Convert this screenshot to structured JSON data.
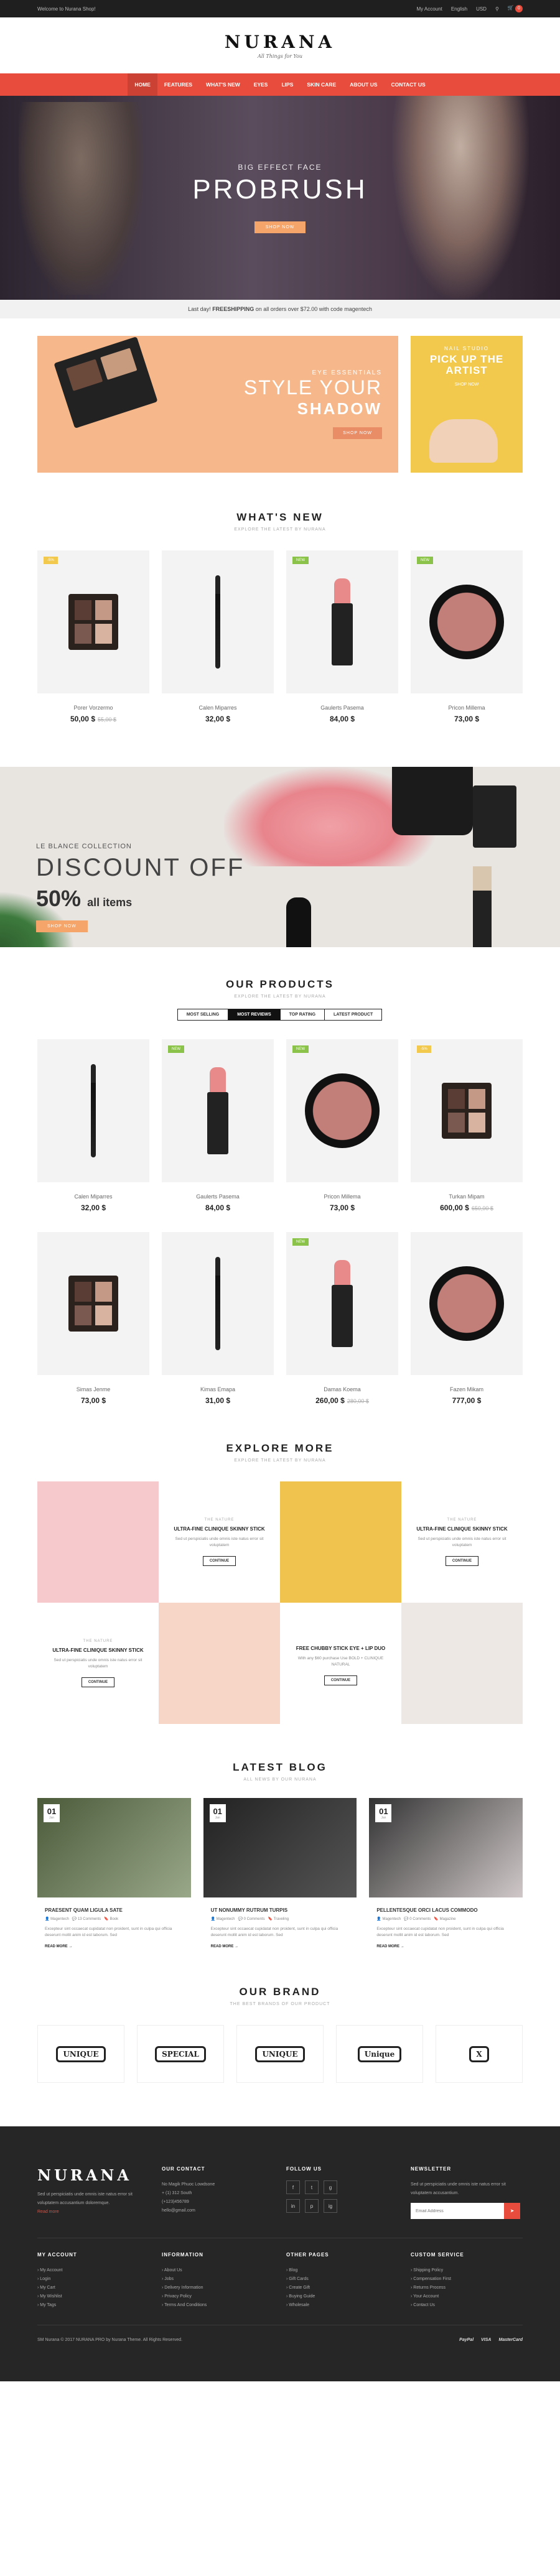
{
  "topbar": {
    "welcome": "Welcome to Nurana Shop!",
    "account": "My Account",
    "language": "English",
    "currency": "USD",
    "cart_count": "0"
  },
  "brand": {
    "logo": "NURANA",
    "tagline": "All Things for You"
  },
  "nav": [
    "HOME",
    "FEATURES",
    "WHAT'S NEW",
    "EYES",
    "LIPS",
    "SKIN CARE",
    "ABOUT US",
    "CONTACT US"
  ],
  "hero": {
    "pre": "BIG EFFECT FACE",
    "title": "PROBRUSH",
    "button": "SHOP NOW"
  },
  "shipping": {
    "pre": "Last day!",
    "bold": "FREESHIPPING",
    "post": "on all orders over $72.00 with code magentech"
  },
  "promo1": {
    "sub": "EYE ESSENTIALS",
    "title": "STYLE YOUR",
    "title2": "SHADOW",
    "button": "SHOP NOW"
  },
  "promo2": {
    "sub": "NAIL STUDIO",
    "title": "PICK UP THE ARTIST",
    "button": "SHOP NOW"
  },
  "whats_new": {
    "title": "WHAT'S NEW",
    "sub": "EXPLORE THE LATEST BY NURANA",
    "items": [
      {
        "badge": "-5%",
        "badge_color": "#f2c94c",
        "name": "Porer Vorzermo",
        "price": "50,00 $",
        "old": "55,00 $"
      },
      {
        "badge": "",
        "badge_color": "",
        "name": "Calen Miparres",
        "price": "32,00 $",
        "old": ""
      },
      {
        "badge": "NEW",
        "badge_color": "#8bc34a",
        "name": "Gaulerts Pasema",
        "price": "84,00 $",
        "old": ""
      },
      {
        "badge": "NEW",
        "badge_color": "#8bc34a",
        "name": "Pricon Millema",
        "price": "73,00 $",
        "old": ""
      }
    ]
  },
  "discount": {
    "collection": "LE BLANCE COLLECTION",
    "title": "DISCOUNT OFF",
    "percent": "50%",
    "suffix": "all items",
    "button": "SHOP NOW"
  },
  "products": {
    "title": "OUR PRODUCTS",
    "sub": "EXPLORE THE LATEST BY NURANA",
    "tabs": [
      "MOST SELLING",
      "MOST REVIEWS",
      "TOP RATING",
      "LATEST PRODUCT"
    ],
    "items": [
      {
        "badge": "",
        "badge_color": "",
        "name": "Calen Miparres",
        "price": "32,00 $",
        "old": ""
      },
      {
        "badge": "NEW",
        "badge_color": "#8bc34a",
        "name": "Gaulerts Pasema",
        "price": "84,00 $",
        "old": ""
      },
      {
        "badge": "NEW",
        "badge_color": "#8bc34a",
        "name": "Pricon Millema",
        "price": "73,00 $",
        "old": ""
      },
      {
        "badge": "-5%",
        "badge_color": "#f2c94c",
        "name": "Turkan Mipam",
        "price": "600,00 $",
        "old": "650,00 $"
      },
      {
        "badge": "",
        "badge_color": "",
        "name": "Simas Jenme",
        "price": "73,00 $",
        "old": ""
      },
      {
        "badge": "",
        "badge_color": "",
        "name": "Kimas Emapa",
        "price": "31,00 $",
        "old": ""
      },
      {
        "badge": "NEW",
        "badge_color": "#8bc34a",
        "name": "Damas Koema",
        "price": "260,00 $",
        "old": "280,00 $"
      },
      {
        "badge": "",
        "badge_color": "",
        "name": "Fazen Mikam",
        "price": "777,00 $",
        "old": ""
      }
    ]
  },
  "explore": {
    "title": "EXPLORE MORE",
    "sub": "EXPLORE THE LATEST BY NURANA",
    "blocks": [
      {
        "sub": "THE NATURE",
        "title": "ULTRA-FINE CLINIQUE SKINNY STICK",
        "desc": "Sed ut perspiciatis unde omnis iste natus error sit voluptatem",
        "button": "CONTINUE"
      },
      {
        "sub": "THE NATURE",
        "title": "ULTRA-FINE CLINIQUE SKINNY STICK",
        "desc": "Sed ut perspiciatis unde omnis iste natus error sit voluptatem",
        "button": "CONTINUE"
      },
      {
        "sub": "THE NATURE",
        "title": "ULTRA-FINE CLINIQUE SKINNY STICK",
        "desc": "Sed ut perspiciatis unde omnis iste natus error sit voluptatem",
        "button": "CONTINUE"
      },
      {
        "sub": "",
        "title": "FREE CHUBBY STICK EYE + LIP DUO",
        "desc": "With any $60 purchase Use BOLD + CLINIQUE NATURAL",
        "button": "CONTINUE"
      }
    ]
  },
  "blog": {
    "title": "LATEST BLOG",
    "sub": "ALL NEWS BY OUR NURANA",
    "posts": [
      {
        "day": "01",
        "mon": "Jan",
        "title": "PRAESENT QUAM LIGULA SATE",
        "author": "Magentech",
        "comments": "13 Comments",
        "tag": "Book",
        "desc": "Excepteur sint occaecat cupidatat non proident, sunt in culpa qui officia deserunt mollit anim id est laborum. Sed",
        "more": "READ MORE"
      },
      {
        "day": "01",
        "mon": "Jan",
        "title": "UT NONUMMY RUTRUM TURPIS",
        "author": "Magentech",
        "comments": "0 Comments",
        "tag": "Traveling",
        "desc": "Excepteur sint occaecat cupidatat non proident, sunt in culpa qui officia deserunt mollit anim id est laborum. Sed",
        "more": "READ MORE"
      },
      {
        "day": "01",
        "mon": "Jan",
        "title": "PELLENTESQUE ORCI LACUS COMMODO",
        "author": "Magentech",
        "comments": "0 Comments",
        "tag": "Magazine",
        "desc": "Excepteur sint occaecat cupidatat non proident, sunt in culpa qui officia deserunt mollit anim id est laborum. Sed",
        "more": "READ MORE"
      }
    ]
  },
  "brands": {
    "title": "OUR BRAND",
    "sub": "THE BEST BRANDS OF OUR PRODUCT",
    "logos": [
      "UNIQUE",
      "SPECIAL",
      "UNIQUE",
      "Unique",
      "X"
    ]
  },
  "footer": {
    "logo": "NURANA",
    "about": "Sed ut perspiciatis unde omnis iste natus error sit voluptatem accusantium doloremque.",
    "readmore": "Read more",
    "contact_title": "OUR CONTACT",
    "contact": [
      "No Magik Phuoc Lowdsone",
      "+ (1) 312 South",
      "(+123)456789",
      "hello@gmail.com"
    ],
    "follow_title": "FOLLOW US",
    "social": [
      "f",
      "t",
      "g",
      "in",
      "p",
      "ig"
    ],
    "news_title": "NEWSLETTER",
    "news_text": "Sed ut perspiciatis unde omnis iste natus error sit voluptatem accusantium.",
    "news_placeholder": "Email Address",
    "cols": [
      {
        "title": "MY ACCOUNT",
        "items": [
          "My Account",
          "Login",
          "My Cart",
          "My Wishlist",
          "My Tags"
        ]
      },
      {
        "title": "INFORMATION",
        "items": [
          "About Us",
          "Jobs",
          "Delivery Information",
          "Privacy Policy",
          "Terms And Conditions"
        ]
      },
      {
        "title": "OTHER PAGES",
        "items": [
          "Blog",
          "Gift Cards",
          "Create Gift",
          "Buying Guide",
          "Wholesale"
        ]
      },
      {
        "title": "CUSTOM SERVICE",
        "items": [
          "Shipping Policy",
          "Compensation First",
          "Returns Process",
          "Your Account",
          "Contact Us"
        ]
      }
    ],
    "copyright": "SM Nurana © 2017 NURANA PRO by Nurana Theme. All Rights Reserved.",
    "payments": [
      "PayPal",
      "VISA",
      "MasterCard"
    ]
  }
}
